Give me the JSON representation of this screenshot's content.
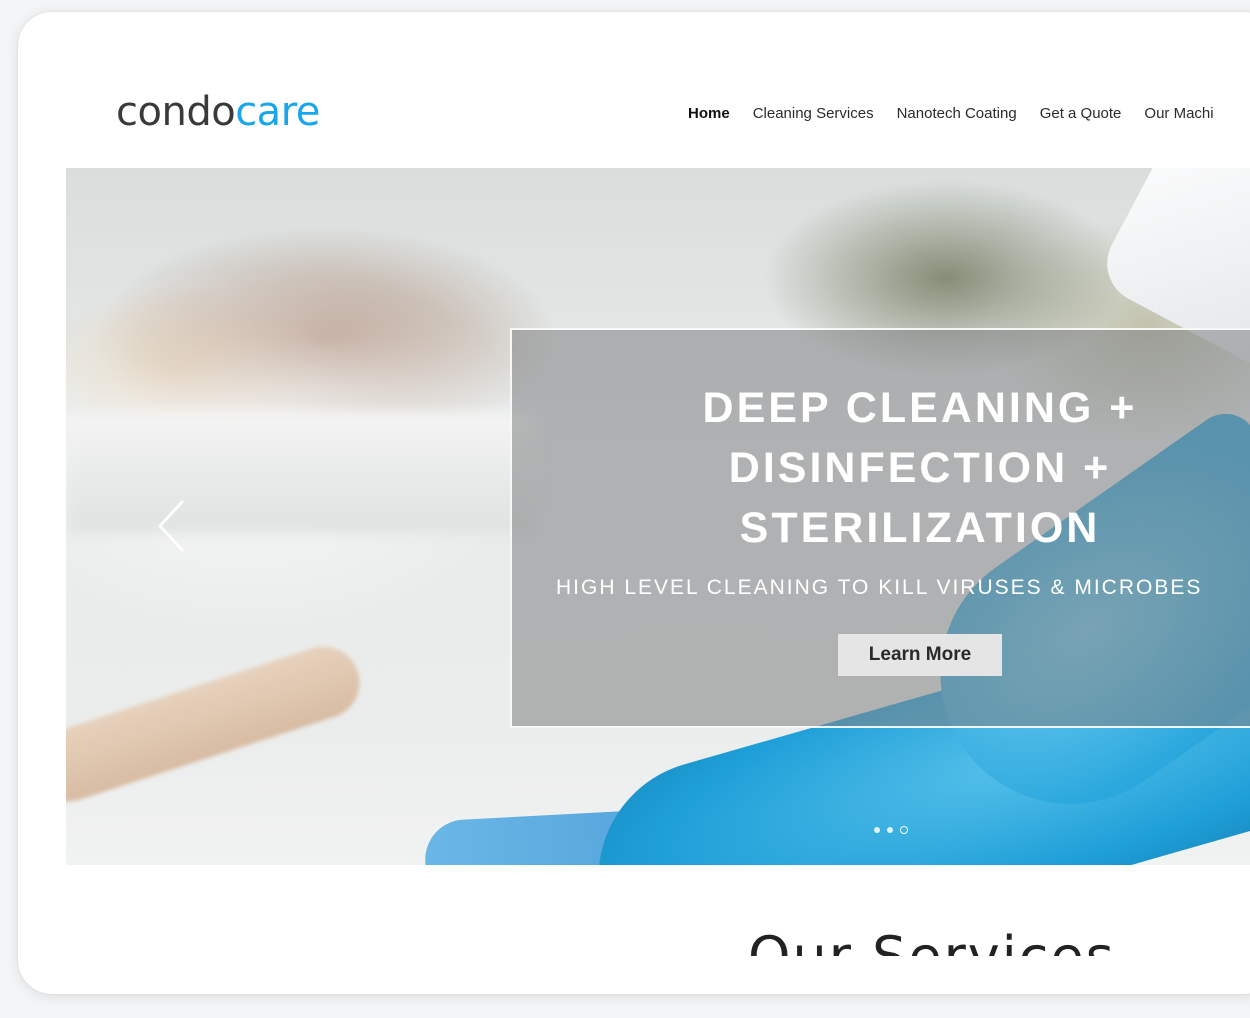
{
  "brand": {
    "part1": "condo",
    "part2": "care",
    "color_primary": "#3a3a3a",
    "color_accent": "#1aa6ea"
  },
  "nav": {
    "items": [
      {
        "label": "Home",
        "active": true
      },
      {
        "label": "Cleaning Services",
        "active": false
      },
      {
        "label": "Nanotech Coating",
        "active": false
      },
      {
        "label": "Get a Quote",
        "active": false
      },
      {
        "label": "Our Machi",
        "active": false
      }
    ]
  },
  "hero": {
    "title_lines": [
      "DEEP CLEANING +",
      "DISINFECTION +",
      "STERILIZATION"
    ],
    "subtitle": "HIGH LEVEL CLEANING TO KILL VIRUSES & MICROBES",
    "cta_label": "Learn More",
    "prev_icon": "chevron-left-icon",
    "slides_total": 3,
    "slide_current": 3
  },
  "services": {
    "heading": "Our Services"
  }
}
